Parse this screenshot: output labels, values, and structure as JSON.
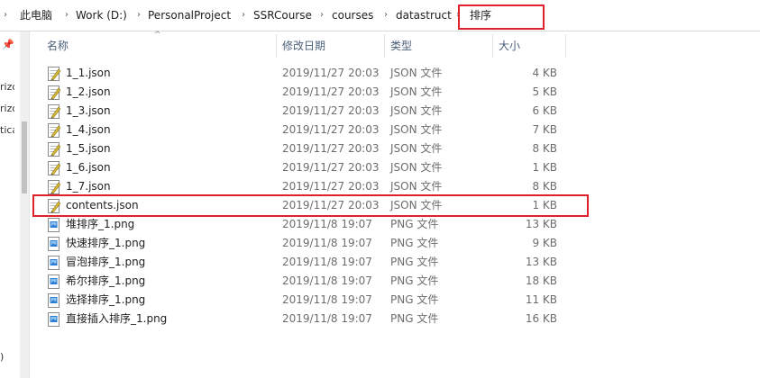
{
  "breadcrumb": {
    "items": [
      "此电脑",
      "Work (D:)",
      "PersonalProject",
      "SSRCourse",
      "courses",
      "datastruct",
      "排序"
    ]
  },
  "nav": {
    "fragments": [
      "rizo",
      "rizo",
      "tica",
      ")"
    ]
  },
  "columns": {
    "name": "名称",
    "date": "修改日期",
    "type": "类型",
    "size": "大小"
  },
  "files": [
    {
      "name": "1_1.json",
      "date": "2019/11/27 20:03",
      "type": "JSON 文件",
      "size": "4 KB",
      "icon": "json-file-icon"
    },
    {
      "name": "1_2.json",
      "date": "2019/11/27 20:03",
      "type": "JSON 文件",
      "size": "5 KB",
      "icon": "json-file-icon"
    },
    {
      "name": "1_3.json",
      "date": "2019/11/27 20:03",
      "type": "JSON 文件",
      "size": "6 KB",
      "icon": "json-file-icon"
    },
    {
      "name": "1_4.json",
      "date": "2019/11/27 20:03",
      "type": "JSON 文件",
      "size": "7 KB",
      "icon": "json-file-icon"
    },
    {
      "name": "1_5.json",
      "date": "2019/11/27 20:03",
      "type": "JSON 文件",
      "size": "8 KB",
      "icon": "json-file-icon"
    },
    {
      "name": "1_6.json",
      "date": "2019/11/27 20:03",
      "type": "JSON 文件",
      "size": "1 KB",
      "icon": "json-file-icon"
    },
    {
      "name": "1_7.json",
      "date": "2019/11/27 20:03",
      "type": "JSON 文件",
      "size": "8 KB",
      "icon": "json-file-icon"
    },
    {
      "name": "contents.json",
      "date": "2019/11/27 20:03",
      "type": "JSON 文件",
      "size": "1 KB",
      "icon": "json-file-icon"
    },
    {
      "name": "堆排序_1.png",
      "date": "2019/11/8 19:07",
      "type": "PNG 文件",
      "size": "13 KB",
      "icon": "png-file-icon"
    },
    {
      "name": "快速排序_1.png",
      "date": "2019/11/8 19:07",
      "type": "PNG 文件",
      "size": "9 KB",
      "icon": "png-file-icon"
    },
    {
      "name": "冒泡排序_1.png",
      "date": "2019/11/8 19:07",
      "type": "PNG 文件",
      "size": "13 KB",
      "icon": "png-file-icon"
    },
    {
      "name": "希尔排序_1.png",
      "date": "2019/11/8 19:07",
      "type": "PNG 文件",
      "size": "18 KB",
      "icon": "png-file-icon"
    },
    {
      "name": "选择排序_1.png",
      "date": "2019/11/8 19:07",
      "type": "PNG 文件",
      "size": "11 KB",
      "icon": "png-file-icon"
    },
    {
      "name": "直接插入排序_1.png",
      "date": "2019/11/8 19:07",
      "type": "PNG 文件",
      "size": "16 KB",
      "icon": "png-file-icon"
    }
  ],
  "colors": {
    "highlight": "#e0202a",
    "header_text": "#4c607a",
    "meta_text": "#6d6d6d"
  }
}
